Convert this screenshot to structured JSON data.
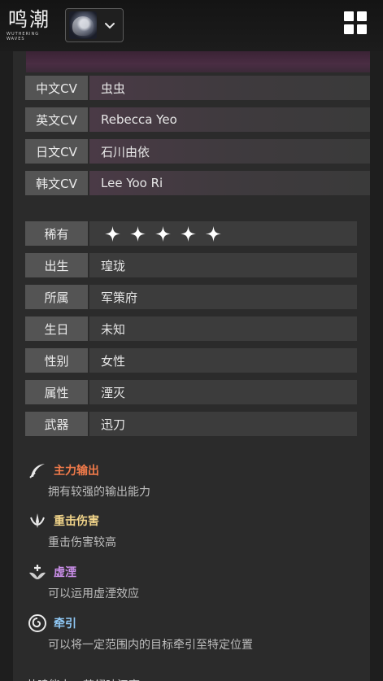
{
  "header": {
    "logo_cn": "鸣潮",
    "logo_en": "WUTHERING WAVES",
    "grid_menu_icon": "grid-menu-icon",
    "game_select_icon": "chevron-down-icon"
  },
  "cv": [
    {
      "label": "中文CV",
      "value": "虫虫"
    },
    {
      "label": "英文CV",
      "value": "Rebecca Yeo"
    },
    {
      "label": "日文CV",
      "value": "石川由依"
    },
    {
      "label": "韩文CV",
      "value": "Lee Yoo Ri"
    }
  ],
  "attributes": {
    "rarity": {
      "label": "稀有",
      "stars": 5
    },
    "items": [
      {
        "label": "出生",
        "value": "瑝珑"
      },
      {
        "label": "所属",
        "value": "军策府"
      },
      {
        "label": "生日",
        "value": "未知"
      },
      {
        "label": "性别",
        "value": "女性"
      },
      {
        "label": "属性",
        "value": "湮灭"
      },
      {
        "label": "武器",
        "value": "迅刀"
      }
    ]
  },
  "tags": [
    {
      "title": "主力输出",
      "desc": "拥有较强的输出能力",
      "color": "#f07a4a",
      "icon": "blade-icon"
    },
    {
      "title": "重击伤害",
      "desc": "重击伤害较高",
      "color": "#f2d58a",
      "icon": "heavy-attack-icon"
    },
    {
      "title": "虚湮",
      "desc": "可以运用虚湮效应",
      "color": "#c98ee8",
      "icon": "havoc-icon"
    },
    {
      "title": "牵引",
      "desc": "可以将一定范围内的目标牵引至特定位置",
      "color": "#8fc8f5",
      "icon": "pull-icon"
    }
  ],
  "footer": {
    "text": "共鸣能力：苍翎映江亭"
  }
}
